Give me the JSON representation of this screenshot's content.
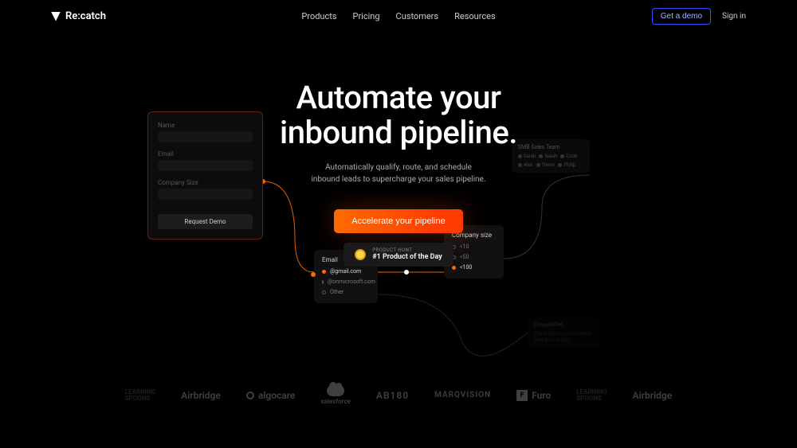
{
  "brand": "Re:catch",
  "nav": {
    "products": "Products",
    "pricing": "Pricing",
    "customers": "Customers",
    "resources": "Resources"
  },
  "header": {
    "demo": "Get a demo",
    "signin": "Sign in"
  },
  "hero": {
    "title_line1": "Automate your",
    "title_line2": "inbound pipeline.",
    "sub_line1": "Automatically qualify, route, and schedule",
    "sub_line2": "inbound leads to supercharge your sales pipeline.",
    "cta": "Accelerate your pipeline",
    "ph_label": "PRODUCT HUNT",
    "ph_title": "#1 Product of the Day"
  },
  "form": {
    "name_label": "Name",
    "email_label": "Email",
    "size_label": "Company Size",
    "submit": "Request Demo"
  },
  "emailCard": {
    "title": "Email",
    "opt1": "@gmail.com",
    "opt2": "@onmicrosoft.com",
    "opt3": "Other"
  },
  "sizeCard": {
    "title": "Company size",
    "opt1": "<10",
    "opt2": "<50",
    "opt3": "<100"
  },
  "team": {
    "title": "SMB Sales Team",
    "m1": "Sarah",
    "m2": "Isaiah",
    "m3": "Cook",
    "m4": "Alex",
    "m5": "Trevor",
    "m6": "Philip"
  },
  "dis": {
    "title": "Disqualified",
    "body": "Thank you for your interest. We'll be in touch."
  },
  "logos": {
    "learning": "LEARNING",
    "spoons": "SPOONS",
    "airbridge": "Airbridge",
    "algocare": "algocare",
    "salesforce": "salesforce",
    "ab180": "AB180",
    "marqvision": "MARQVISION",
    "furo": "Furo"
  }
}
